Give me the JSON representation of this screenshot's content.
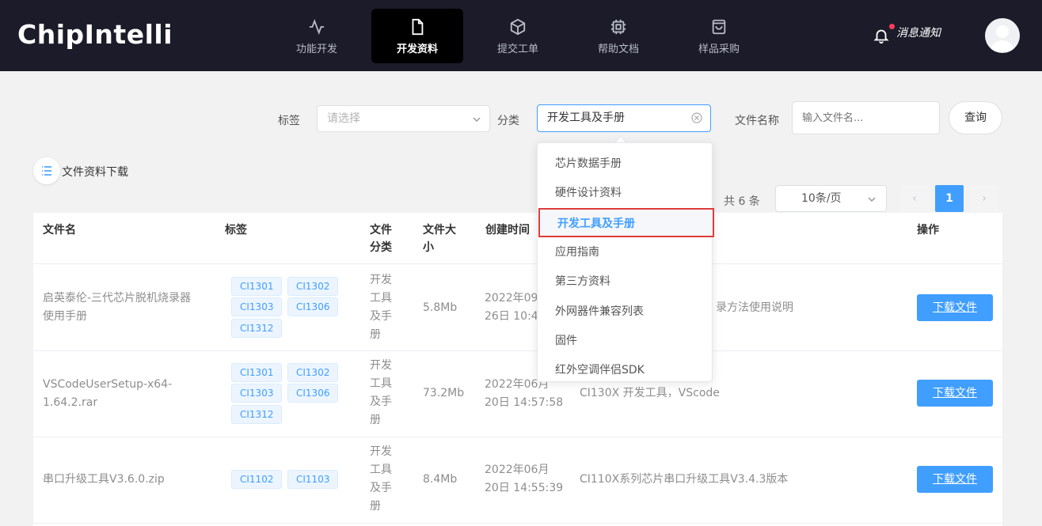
{
  "header": {
    "logo": "ChipIntelli",
    "nav": [
      {
        "label": "功能开发",
        "icon": "activity-icon"
      },
      {
        "label": "开发资料",
        "icon": "document-icon",
        "active": true
      },
      {
        "label": "提交工单",
        "icon": "cube-icon"
      },
      {
        "label": "帮助文档",
        "icon": "chip-icon"
      },
      {
        "label": "样品采购",
        "icon": "shopping-bag-icon"
      }
    ],
    "notify_label": "消息通知"
  },
  "filters": {
    "tag_label": "标签",
    "tag_placeholder": "请选择",
    "category_label": "分类",
    "category_value": "开发工具及手册",
    "filename_label": "文件名称",
    "filename_placeholder": "输入文件名...",
    "query_button": "查询"
  },
  "section_title": "文件资料下载",
  "pagination": {
    "total_text": "共 6 条",
    "page_size": "10条/页",
    "prev": "‹",
    "current_page": "1",
    "next": "›"
  },
  "dropdown": {
    "items": [
      "芯片数据手册",
      "硬件设计资料",
      "开发工具及手册",
      "应用指南",
      "第三方资料",
      "外网器件兼容列表",
      "固件",
      "红外空调伴侣SDK"
    ],
    "selected": "开发工具及手册"
  },
  "table": {
    "headers": {
      "filename": "文件名",
      "tags": "标签",
      "category_line1": "文件",
      "category_line2": "分类",
      "size_line1": "文件大",
      "size_line2": "小",
      "created": "创建时间",
      "actions": "操作"
    },
    "rows": [
      {
        "filename_line1": "启英泰伦-三代芯片脱机烧录器",
        "filename_line2": "使用手册",
        "tags": [
          "CI1301",
          "CI1302",
          "CI1303",
          "CI1306",
          "CI1312"
        ],
        "category_lines": [
          "开发",
          "工具",
          "及手",
          "册"
        ],
        "size": "5.8Mb",
        "created_line1": "2022年09",
        "created_line2": "26日 10:4",
        "description": "录方法使用说明",
        "action": "下载文件"
      },
      {
        "filename_line1": "VSCodeUserSetup-x64-",
        "filename_line2": "1.64.2.rar",
        "tags": [
          "CI1301",
          "CI1302",
          "CI1303",
          "CI1306",
          "CI1312"
        ],
        "category_lines": [
          "开发",
          "工具",
          "及手",
          "册"
        ],
        "size": "73.2Mb",
        "created_line1": "2022年06月",
        "created_line2": "20日 14:57:58",
        "description": "CI130X 开发工具，VScode",
        "action": "下载文件"
      },
      {
        "filename_line1": "串口升级工具V3.6.0.zip",
        "filename_line2": "",
        "tags": [
          "CI1102",
          "CI1103"
        ],
        "category_lines": [
          "开发",
          "工具",
          "及手",
          "册"
        ],
        "size": "8.4Mb",
        "created_line1": "2022年06月",
        "created_line2": "20日 14:55:39",
        "description": "CI110X系列芯片串口升级工具V3.4.3版本",
        "action": "下载文件"
      }
    ]
  },
  "colors": {
    "header_bg": "#1b1b29",
    "accent": "#409eff",
    "highlight_border": "#e03b3b"
  }
}
